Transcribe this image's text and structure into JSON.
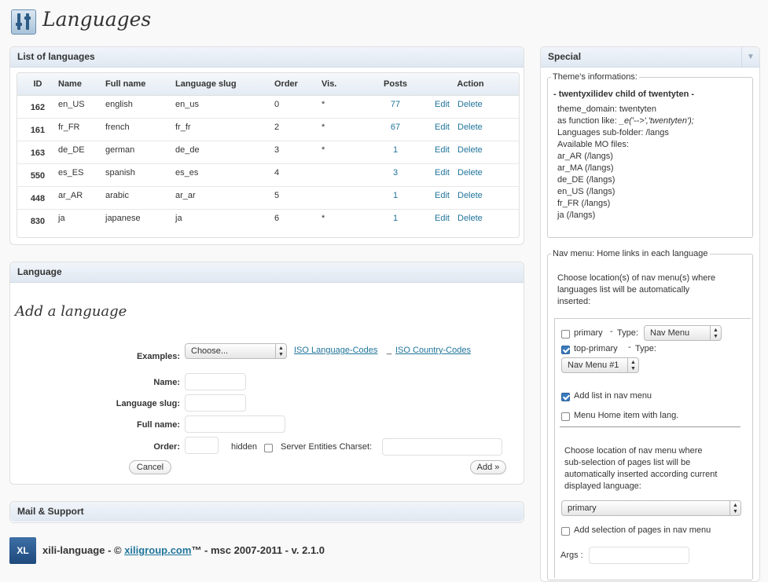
{
  "page": {
    "title": "Languages"
  },
  "list_box": {
    "title": "List of languages",
    "columns": [
      "ID",
      "Name",
      "Full name",
      "Language slug",
      "Order",
      "Vis.",
      "Posts",
      "Action"
    ],
    "rows": [
      {
        "id": "162",
        "name": "en_US",
        "full": "english",
        "slug": "en_us",
        "order": "0",
        "vis": "*",
        "posts": "77",
        "edit": "Edit",
        "del": "Delete"
      },
      {
        "id": "161",
        "name": "fr_FR",
        "full": "french",
        "slug": "fr_fr",
        "order": "2",
        "vis": "*",
        "posts": "67",
        "edit": "Edit",
        "del": "Delete"
      },
      {
        "id": "163",
        "name": "de_DE",
        "full": "german",
        "slug": "de_de",
        "order": "3",
        "vis": "*",
        "posts": "1",
        "edit": "Edit",
        "del": "Delete"
      },
      {
        "id": "550",
        "name": "es_ES",
        "full": "spanish",
        "slug": "es_es",
        "order": "4",
        "vis": "",
        "posts": "3",
        "edit": "Edit",
        "del": "Delete"
      },
      {
        "id": "448",
        "name": "ar_AR",
        "full": "arabic",
        "slug": "ar_ar",
        "order": "5",
        "vis": "",
        "posts": "1",
        "edit": "Edit",
        "del": "Delete"
      },
      {
        "id": "830",
        "name": "ja",
        "full": "japanese",
        "slug": "ja",
        "order": "6",
        "vis": "*",
        "posts": "1",
        "edit": "Edit",
        "del": "Delete"
      }
    ]
  },
  "language_box": {
    "title": "Language",
    "subtitle": "Add a language",
    "examples_label": "Examples:",
    "examples_value": "Choose...",
    "iso_language_link": "ISO Language-Codes",
    "separator": "_",
    "iso_country_link": "ISO Country-Codes",
    "name_label": "Name:",
    "slug_label": "Language slug:",
    "fullname_label": "Full name:",
    "order_label": "Order:",
    "hidden_label": "hidden",
    "charset_label": "Server Entities Charset:",
    "cancel": "Cancel",
    "add": "Add »"
  },
  "mail_box": {
    "title": "Mail & Support"
  },
  "footer": {
    "logo": "XL",
    "prefix": "xili-language - © ",
    "link": "xiligroup.com",
    "suffix": "™ - msc 2007-2011 - v. 2.1.0"
  },
  "special": {
    "title": "Special",
    "toggle": "▼",
    "theme_legend": "Theme's informations:",
    "theme_heading": "- twentyxilidev child of twentyten -",
    "theme_domain": "theme_domain: twentyten",
    "function_prefix": "as function like: ",
    "function_code": "_e('-->','twentyten');",
    "subfolder": "Languages sub-folder: /langs",
    "mo_heading": "Available MO files:",
    "mo_files": [
      "ar_AR (/langs)",
      "ar_MA (/langs)",
      "de_DE (/langs)",
      "en_US (/langs)",
      "fr_FR (/langs)",
      "ja (/langs)"
    ],
    "nav_legend": "Nav menu: Home links in each language",
    "nav_intro": [
      "Choose location(s) of nav menu(s) where",
      "languages list will be automatically",
      "inserted:"
    ],
    "loc_primary": "primary",
    "type_dash": "-",
    "type_label": "Type:",
    "primary_type_value": "Nav Menu",
    "loc_top_primary": "top-primary",
    "top_type_value": "Nav Menu #1",
    "add_list_label": "Add list in nav menu",
    "home_item_label": "Menu Home item with lang.",
    "pages_intro": [
      "Choose location of nav menu where",
      "sub-selection of pages list will be",
      "automatically inserted according current",
      "displayed language:"
    ],
    "pages_location_value": "primary",
    "add_pages_label": "Add selection of pages in nav menu",
    "args_label": "Args :"
  }
}
